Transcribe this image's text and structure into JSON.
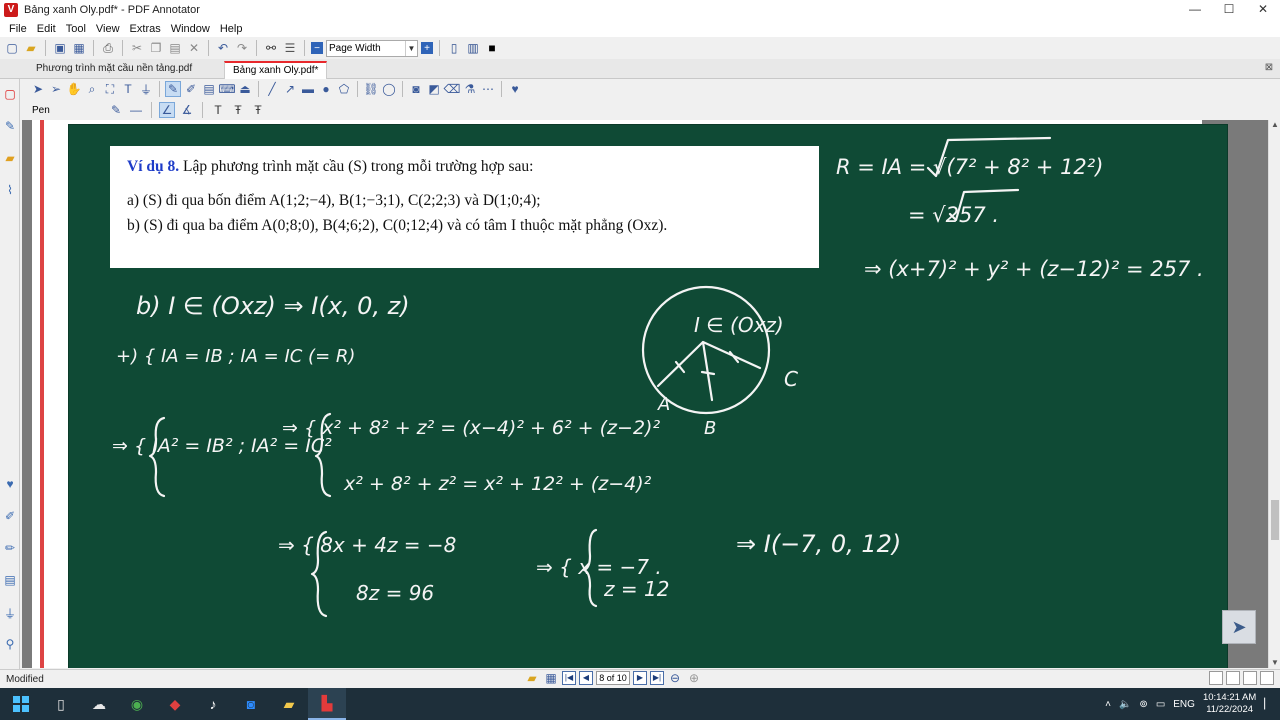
{
  "window": {
    "title": "Bảng xanh Oly.pdf* - PDF Annotator",
    "logo_letter": "V",
    "minimize": "—",
    "maximize": "☐",
    "close": "✕"
  },
  "menu": [
    "File",
    "Edit",
    "Tool",
    "View",
    "Extras",
    "Window",
    "Help"
  ],
  "toolbar": {
    "zoom_value": "Page Width",
    "icons": [
      "new-icon",
      "open-icon",
      "save-icon",
      "save-all-icon",
      "print-icon",
      "cut-icon",
      "copy-icon",
      "paste-icon",
      "delete-icon",
      "undo-icon",
      "redo-icon",
      "binoculars-icon",
      "list-icon",
      "zoom-out-icon",
      "zoom-in-icon"
    ]
  },
  "tabs": [
    {
      "label": "Phương trình mặt cầu nền tảng.pdf",
      "active": false
    },
    {
      "label": "Bảng xanh Oly.pdf*",
      "active": true
    }
  ],
  "tool": {
    "label": "Pen"
  },
  "problem": {
    "heading": "Ví dụ 8.",
    "line1": " Lập phương trình mặt cầu (S) trong mỗi trường hợp sau:",
    "line_a": "a) (S) đi qua bốn điểm A(1;2;−4), B(1;−3;1), C(2;2;3) và D(1;0;4);",
    "line_b": "b) (S) đi qua ba điểm A(0;8;0), B(4;6;2), C(0;12;4) và có tâm I thuộc mặt phẳng (Oxz)."
  },
  "board_colors": {
    "board": "#0f4a35",
    "chalk": "#f4f4f4"
  },
  "handwriting": {
    "r_line1": "R = IA = √(7² + 8² + 12²)",
    "r_line2": "= √257 .",
    "eq_final": "⇒ (x+7)² + y² + (z−12)² = 257 .",
    "b_line": "b) I ∈ (Oxz) ⇒ I(x, 0, z)",
    "sys_hint": "+) { IA = IB ; IA = IC  (= R)",
    "sys2_left": "⇒ { IA² = IB² ; IA² = IC²",
    "sys2_right_1": "⇒ { x² + 8² + z² = (x−4)² + 6² + (z−2)²",
    "sys2_right_2": "x² + 8² + z² = x² + 12² + (z−4)²",
    "sys3_1": "⇒ { 8x + 4z = −8",
    "sys3_2": "8z = 96",
    "sol_1": "⇒ { x = −7 .",
    "sol_2": "z = 12",
    "center": "⇒ I(−7, 0, 12)",
    "fig_label_center": "I ∈ (Oxz)",
    "fig_A": "A",
    "fig_B": "B",
    "fig_C": "C"
  },
  "status": {
    "text": "Modified",
    "page": "8 of 10"
  },
  "taskbar": {
    "lang": "ENG",
    "time": "10:14:21 AM",
    "date": "11/22/2024"
  }
}
